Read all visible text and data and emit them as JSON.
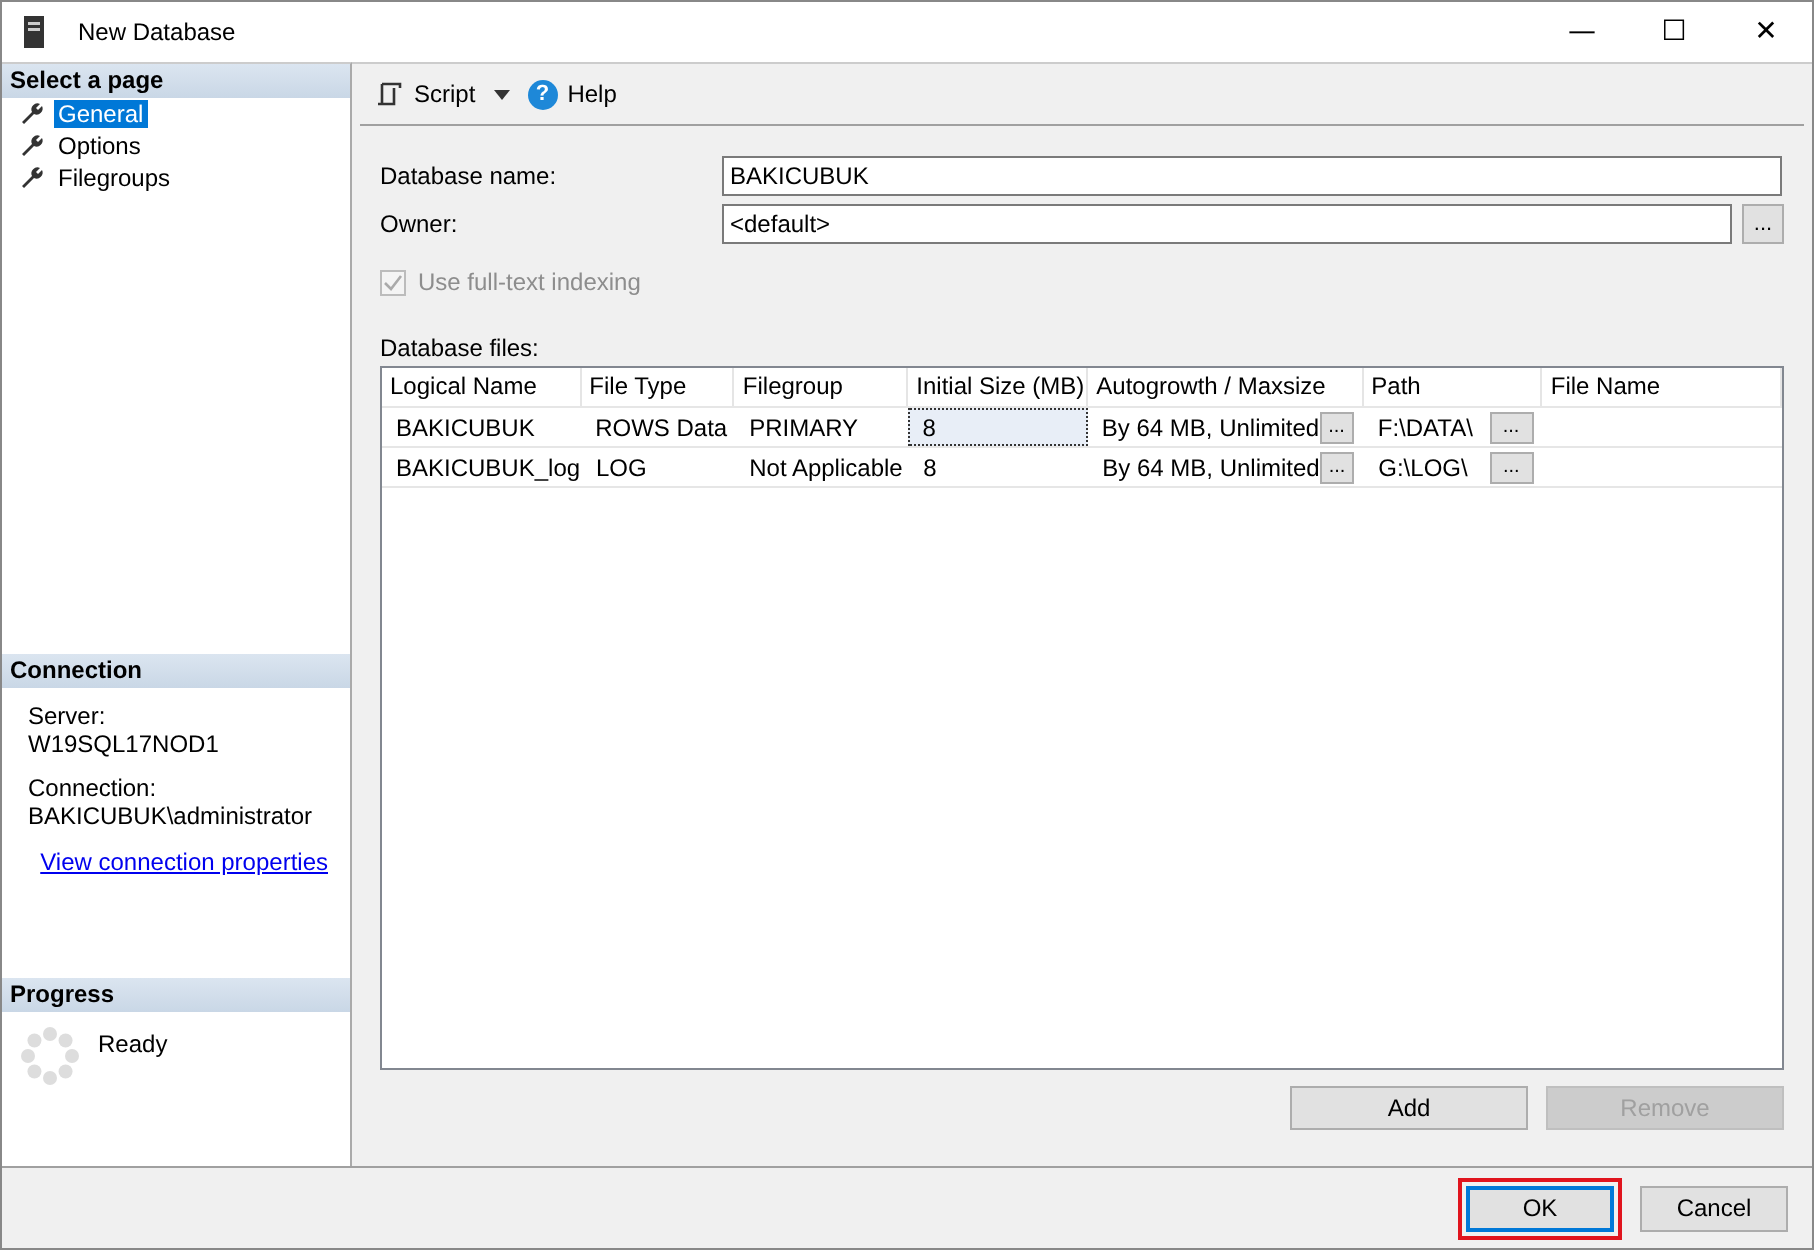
{
  "window": {
    "title": "New Database",
    "controls": [
      "—",
      "☐",
      "✕"
    ]
  },
  "sidebar": {
    "header": "Select a page",
    "items": [
      {
        "label": "General",
        "selected": true
      },
      {
        "label": "Options",
        "selected": false
      },
      {
        "label": "Filegroups",
        "selected": false
      }
    ]
  },
  "connection": {
    "header": "Connection",
    "server_label": "Server:",
    "server": "W19SQL17NOD1",
    "connection_label": "Connection:",
    "connection": "BAKICUBUK\\administrator",
    "link": "View connection properties"
  },
  "progress": {
    "header": "Progress",
    "status": "Ready"
  },
  "toolbar": {
    "script": "Script",
    "help_icon": "?",
    "help": "Help"
  },
  "form": {
    "name_label": "Database name:",
    "name_value": "BAKICUBUK",
    "owner_label": "Owner:",
    "owner_value": "<default>",
    "owner_button": "...",
    "fulltext_label": "Use full-text indexing",
    "fulltext_checked": true,
    "fulltext_disabled": true
  },
  "files": {
    "label": "Database files:",
    "columns": [
      "Logical Name",
      "File Type",
      "Filegroup",
      "Initial Size (MB)",
      "Autogrowth / Maxsize",
      "Path",
      "File Name"
    ],
    "rows": [
      {
        "logical_name": "BAKICUBUK",
        "file_type": "ROWS Data",
        "filegroup": "PRIMARY",
        "initial_size": "8",
        "size_focused": true,
        "autogrowth": "By 64 MB, Unlimited",
        "autogrowth_button": "...",
        "path": "F:\\DATA\\",
        "path_button": "..."
      },
      {
        "logical_name": "BAKICUBUK_log",
        "file_type": "LOG",
        "filegroup": "Not Applicable",
        "initial_size": "8",
        "size_focused": false,
        "autogrowth": "By 64 MB, Unlimited",
        "autogrowth_button": "...",
        "path": "G:\\LOG\\",
        "path_button": "..."
      }
    ]
  },
  "grid_buttons": [
    {
      "label": "Add",
      "disabled": false
    },
    {
      "label": "Remove",
      "disabled": true
    }
  ],
  "buttons": [
    {
      "label": "OK",
      "highlighted": true
    },
    {
      "label": "Cancel",
      "highlighted": false
    }
  ]
}
